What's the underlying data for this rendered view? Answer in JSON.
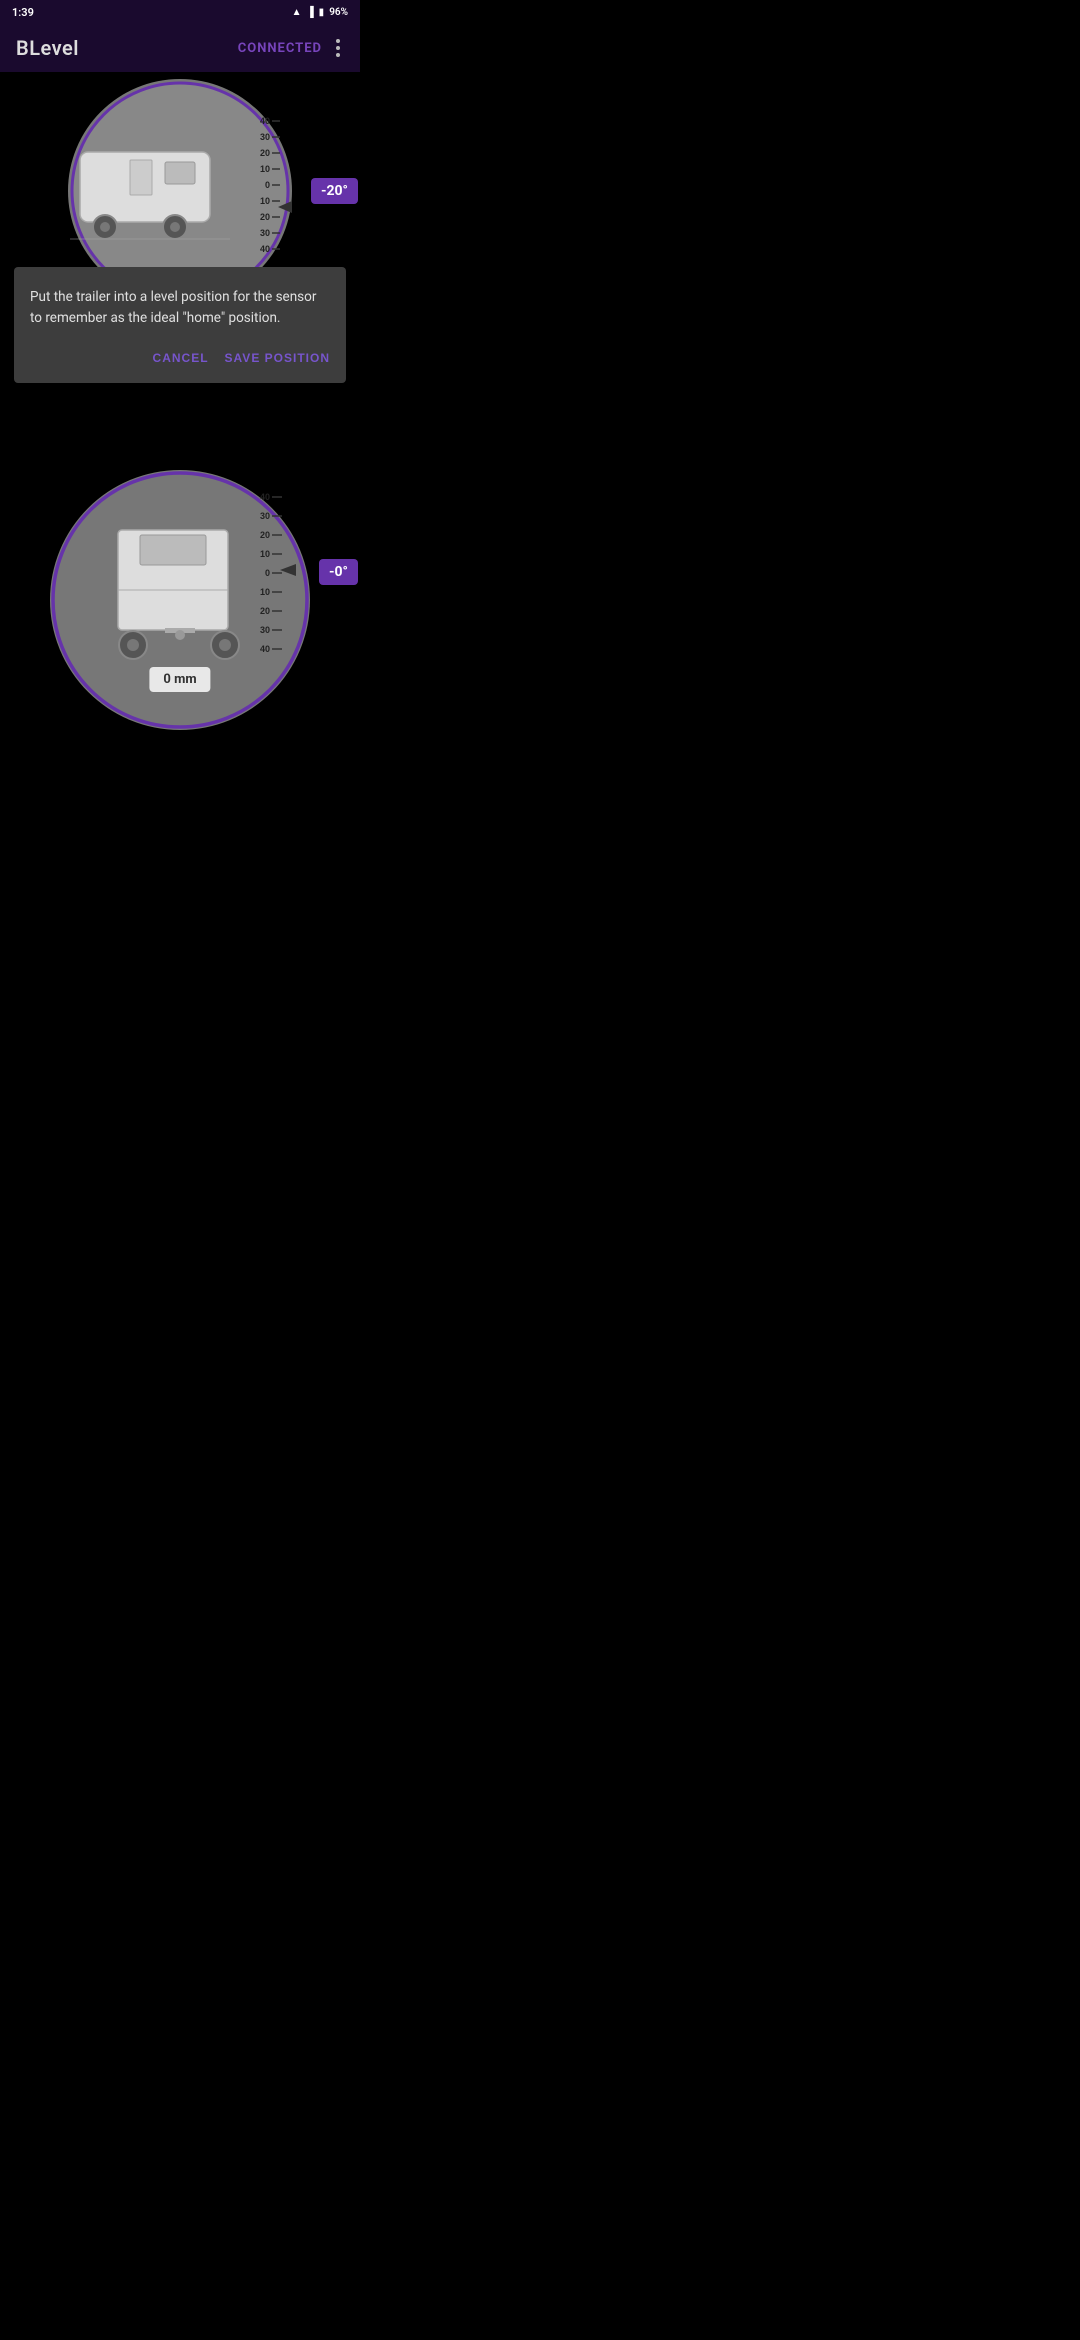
{
  "statusBar": {
    "time": "1:39",
    "battery": "96%",
    "batteryIcon": "🔋",
    "wifiIcon": "📶"
  },
  "appBar": {
    "title": "BLevel",
    "connected": "CONNECTED",
    "menuIcon": "⋮"
  },
  "topGauge": {
    "angle": "-20°",
    "scaleMarks": [
      "40",
      "30",
      "20",
      "10",
      "0",
      "10",
      "20",
      "30",
      "40"
    ]
  },
  "dialog": {
    "message": "Put the trailer into a level position for the sensor to remember as the ideal \"home\" position.",
    "cancelLabel": "CANCEL",
    "saveLabel": "SAVE POSITION"
  },
  "bottomGauge": {
    "angle": "-0°",
    "mmValue": "0 mm",
    "scaleMarks": [
      "40",
      "30",
      "20",
      "10",
      "0",
      "10",
      "20",
      "30",
      "40"
    ]
  }
}
